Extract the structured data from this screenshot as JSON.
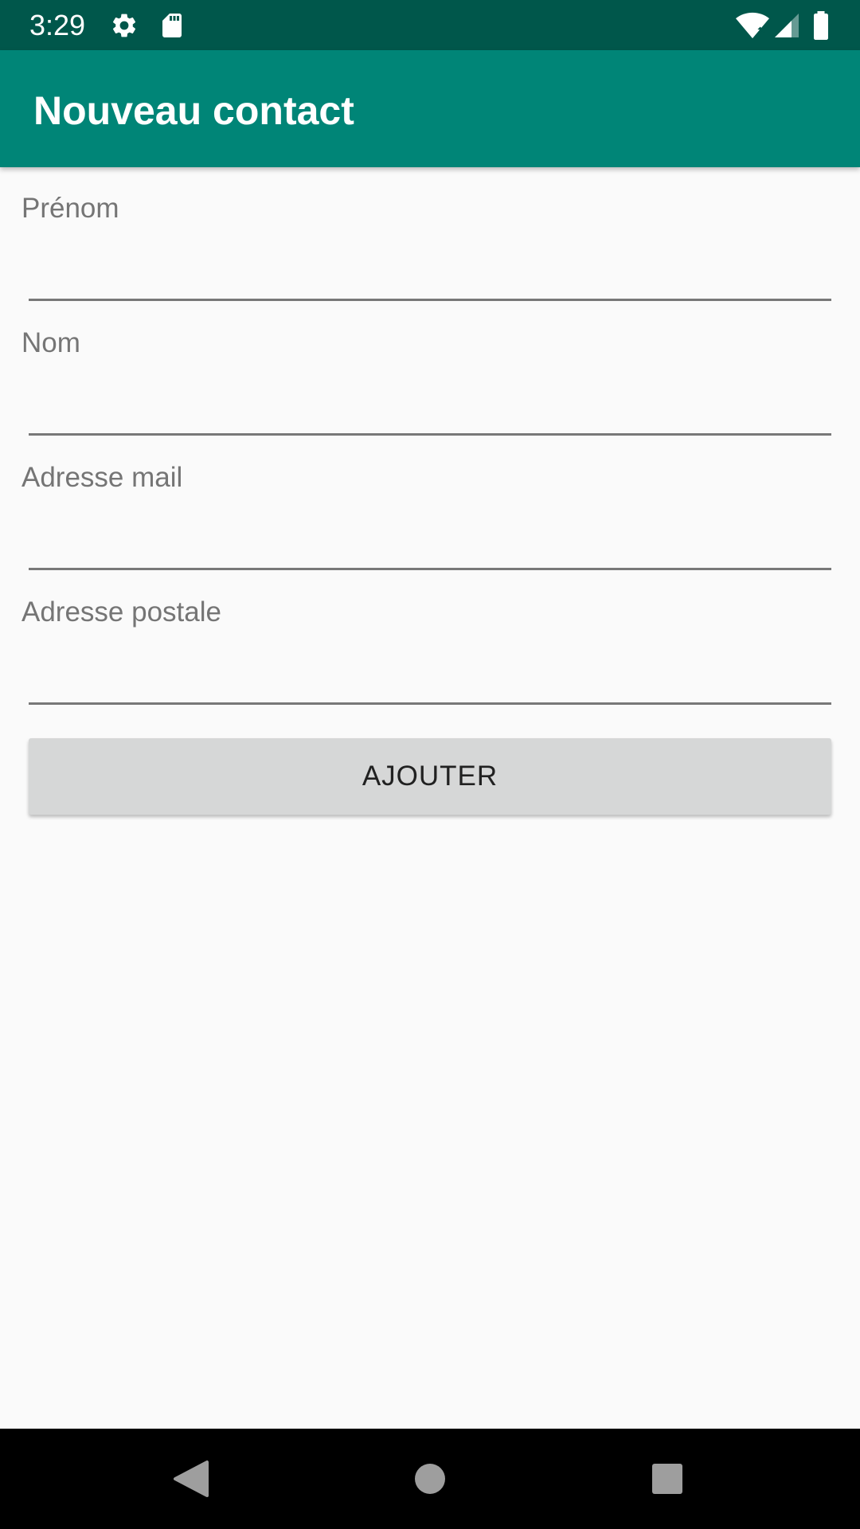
{
  "status_bar": {
    "time": "3:29",
    "icons": [
      "gear-icon",
      "sd-card-icon",
      "wifi-icon",
      "signal-icon",
      "battery-icon"
    ]
  },
  "app_bar": {
    "title": "Nouveau contact",
    "color": "#008577",
    "status_color": "#00574b"
  },
  "form": {
    "fields": [
      {
        "label": "Prénom",
        "value": ""
      },
      {
        "label": "Nom",
        "value": ""
      },
      {
        "label": "Adresse mail",
        "value": ""
      },
      {
        "label": "Adresse postale",
        "value": ""
      }
    ],
    "submit_label": "AJOUTER"
  },
  "nav_bar": {
    "icons": [
      "back-icon",
      "home-icon",
      "recents-icon"
    ]
  }
}
